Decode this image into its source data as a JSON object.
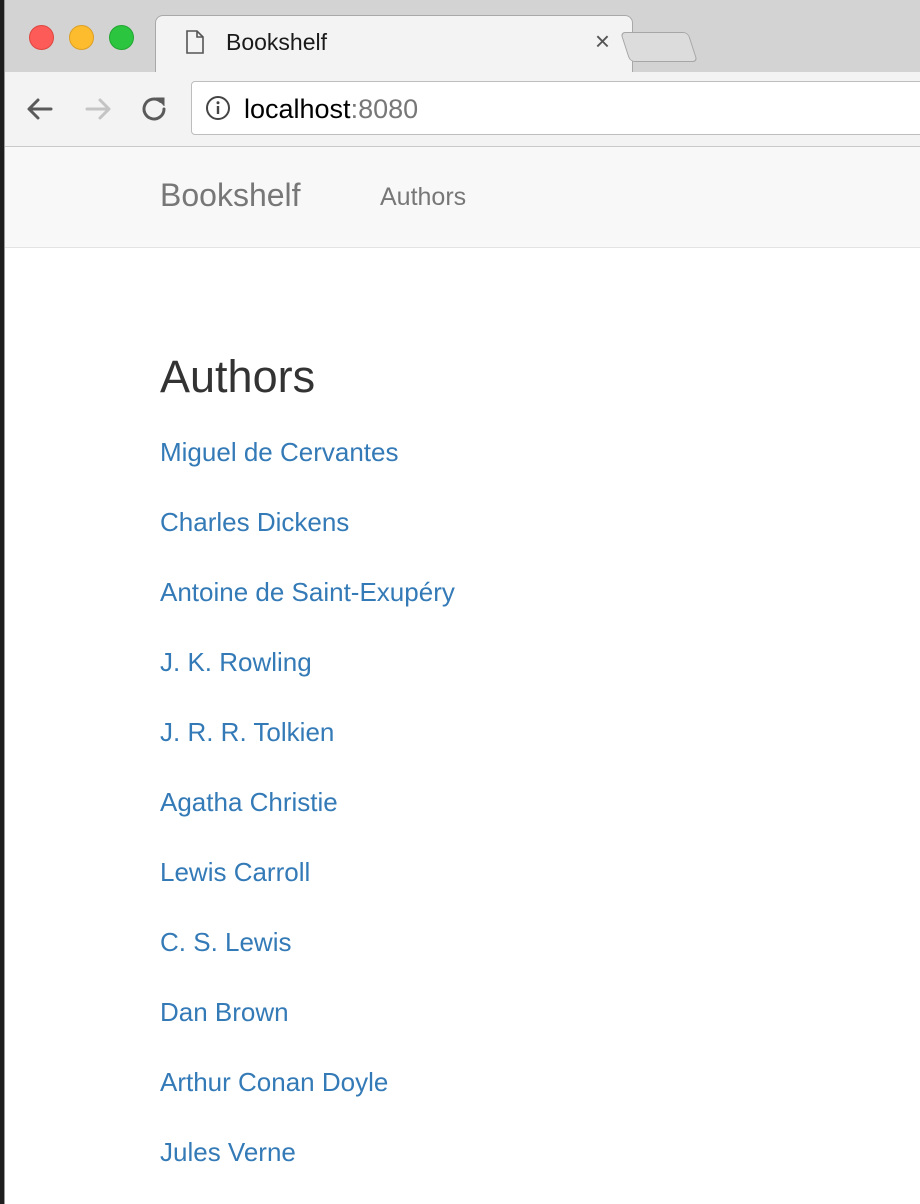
{
  "browser": {
    "tab": {
      "title": "Bookshelf",
      "close_glyph": "×",
      "icon": "page-document-icon"
    },
    "url": {
      "host": "localhost",
      "port": ":8080"
    },
    "buttons": {
      "back_icon": "arrow-left-icon",
      "forward_icon": "arrow-right-icon",
      "reload_icon": "reload-icon",
      "info_icon": "info-icon"
    }
  },
  "navbar": {
    "brand": "Bookshelf",
    "links": [
      "Authors"
    ]
  },
  "main": {
    "heading": "Authors",
    "authors": [
      "Miguel de Cervantes",
      "Charles Dickens",
      "Antoine de Saint-Exupéry",
      "J. K. Rowling",
      "J. R. R. Tolkien",
      "Agatha Christie",
      "Lewis Carroll",
      "C. S. Lewis",
      "Dan Brown",
      "Arthur Conan Doyle",
      "Jules Verne"
    ]
  },
  "colors": {
    "link": "#337ab7",
    "navbar_bg": "#f8f8f8",
    "navbar_text": "#777777",
    "heading": "#333333"
  }
}
